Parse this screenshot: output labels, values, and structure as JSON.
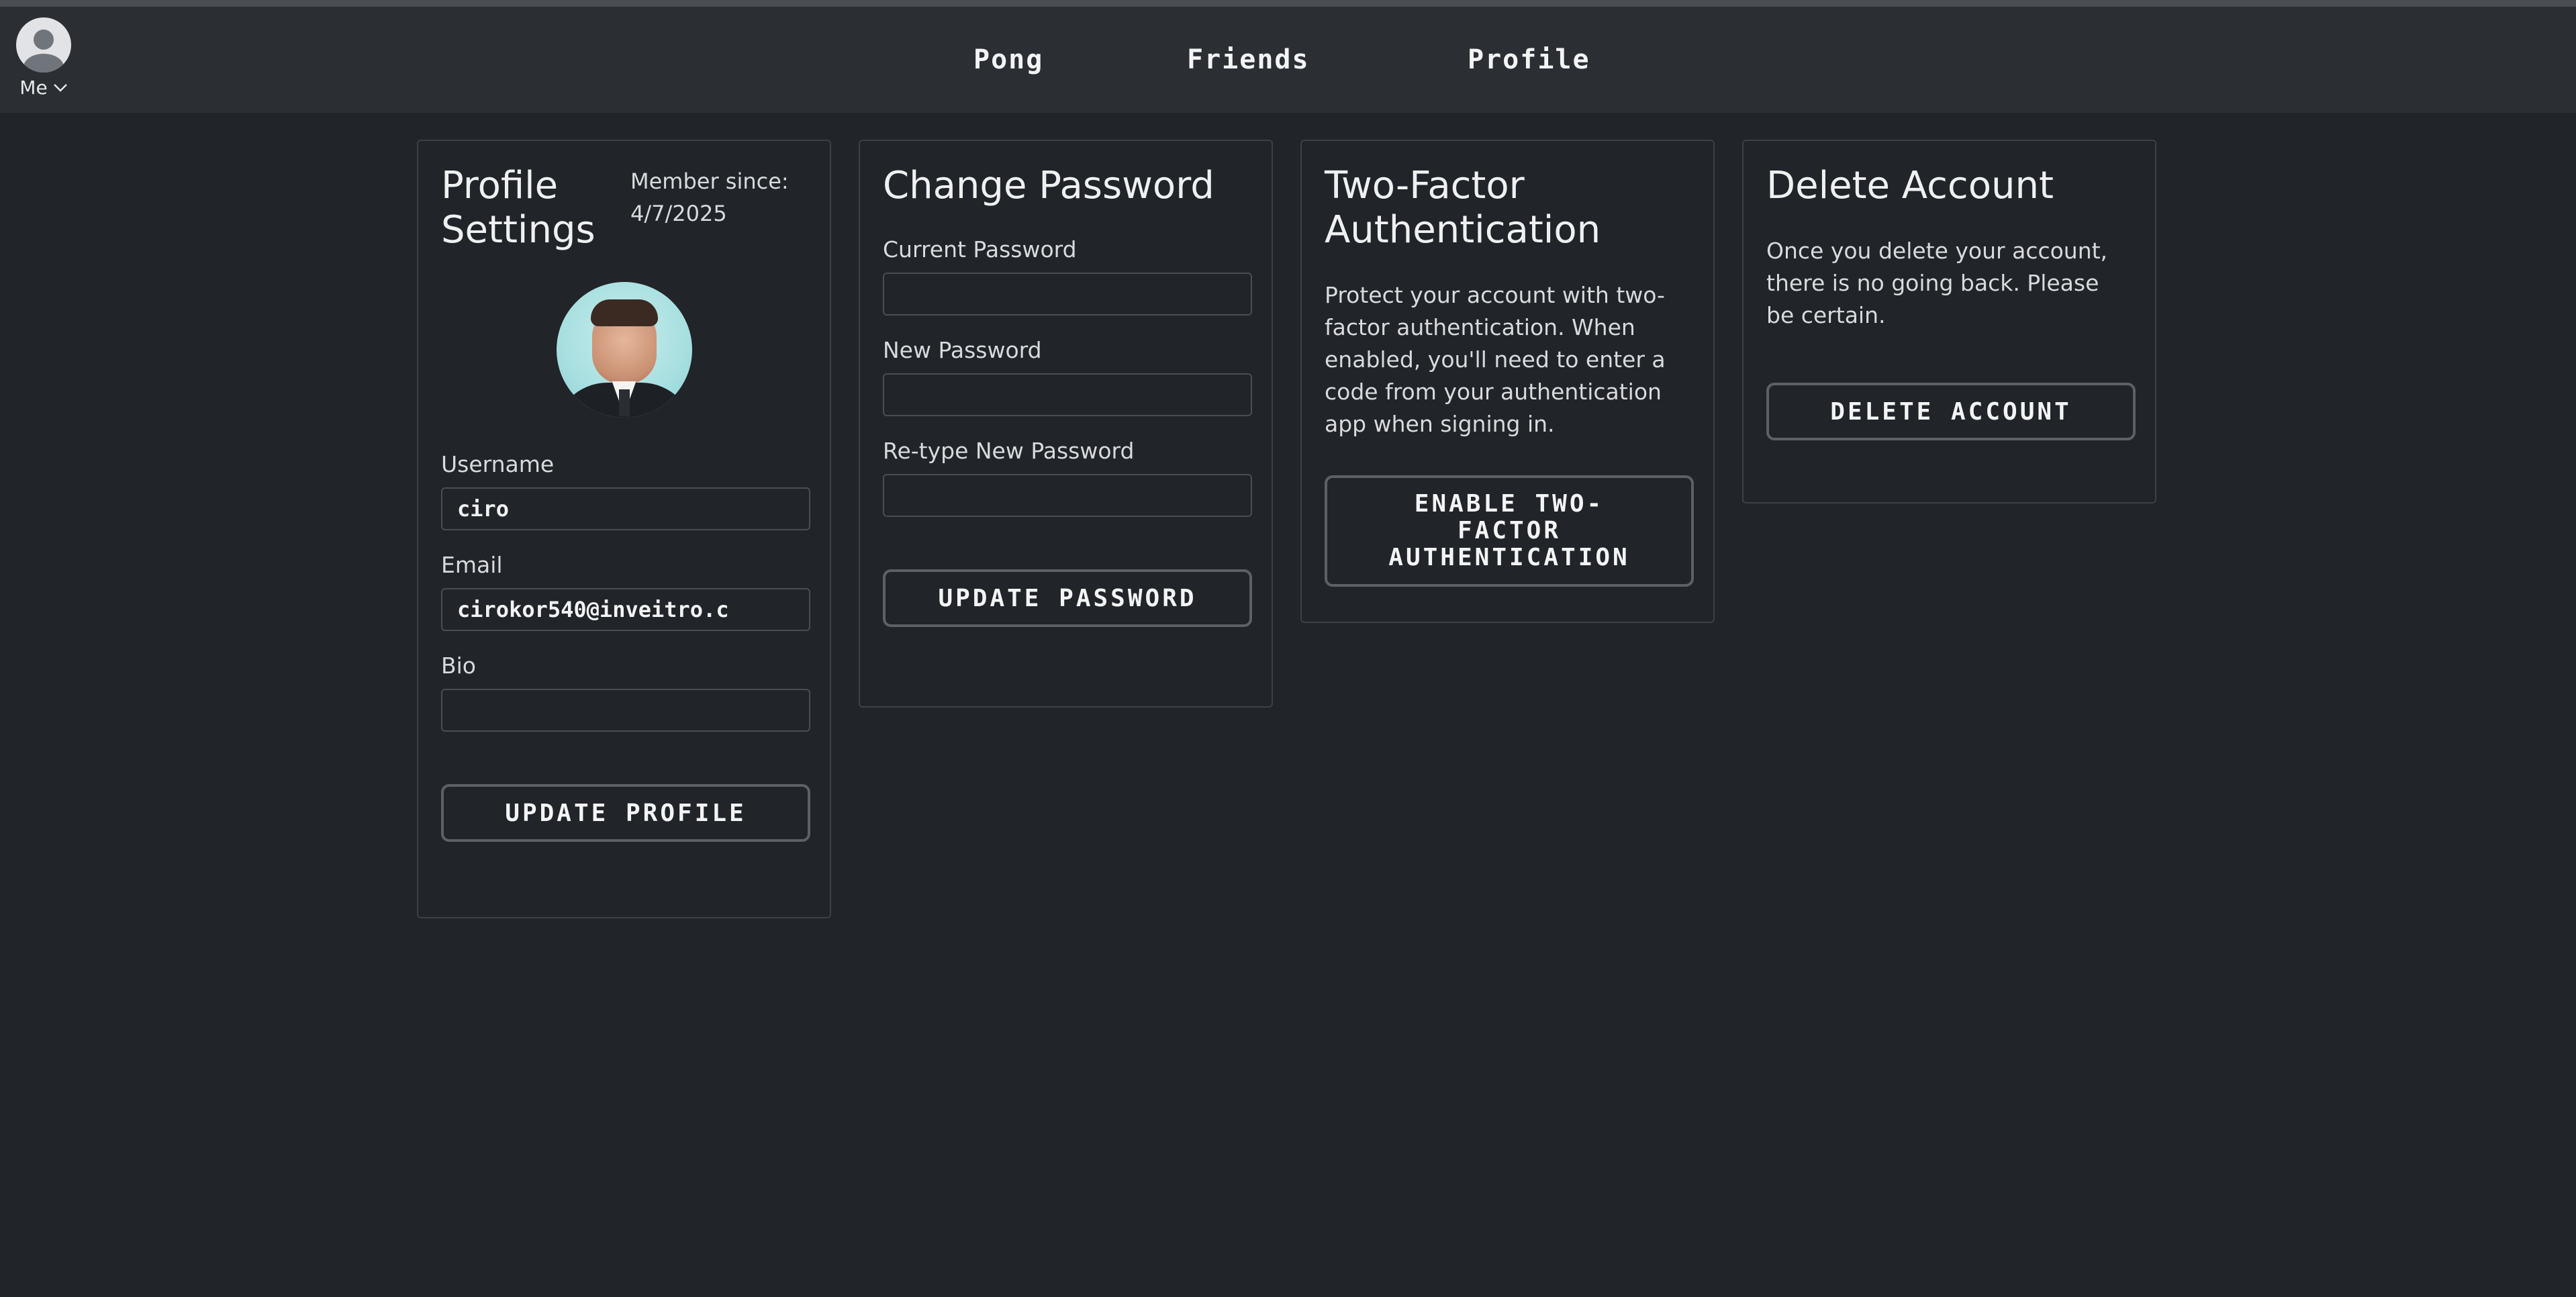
{
  "nav": {
    "me_label": "Me",
    "links": [
      "Pong",
      "Friends",
      "Profile"
    ]
  },
  "profile_settings": {
    "title_line1": "Profile",
    "title_line2": "Settings",
    "member_since_label": "Member since:",
    "member_since_value": "4/7/2025",
    "username_label": "Username",
    "username_value": "ciro",
    "email_label": "Email",
    "email_value": "cirokor540@inveitro.c",
    "bio_label": "Bio",
    "bio_value": "",
    "submit_label": "UPDATE PROFILE"
  },
  "change_password": {
    "title": "Change Password",
    "current_label": "Current Password",
    "new_label": "New Password",
    "retype_label": "Re-type New Password",
    "submit_label": "UPDATE PASSWORD"
  },
  "two_factor": {
    "title_line1": "Two-Factor",
    "title_line2": "Authentication",
    "description": "Protect your account with two-factor authentication. When enabled, you'll need to enter a code from your authentication app when signing in.",
    "button_line1": "ENABLE TWO-",
    "button_line2": "FACTOR",
    "button_line3": "AUTHENTICATION"
  },
  "delete_account": {
    "title": "Delete Account",
    "description": "Once you delete your account, there is no going back. Please be certain.",
    "button_label": "DELETE ACCOUNT"
  },
  "icons": {
    "me": "user-avatar-icon",
    "dropdown": "chevron-down-icon"
  },
  "colors": {
    "background": "#212428",
    "navbar": "#2b2f33",
    "card_border": "#3d4146",
    "button_border": "#5c6166"
  }
}
